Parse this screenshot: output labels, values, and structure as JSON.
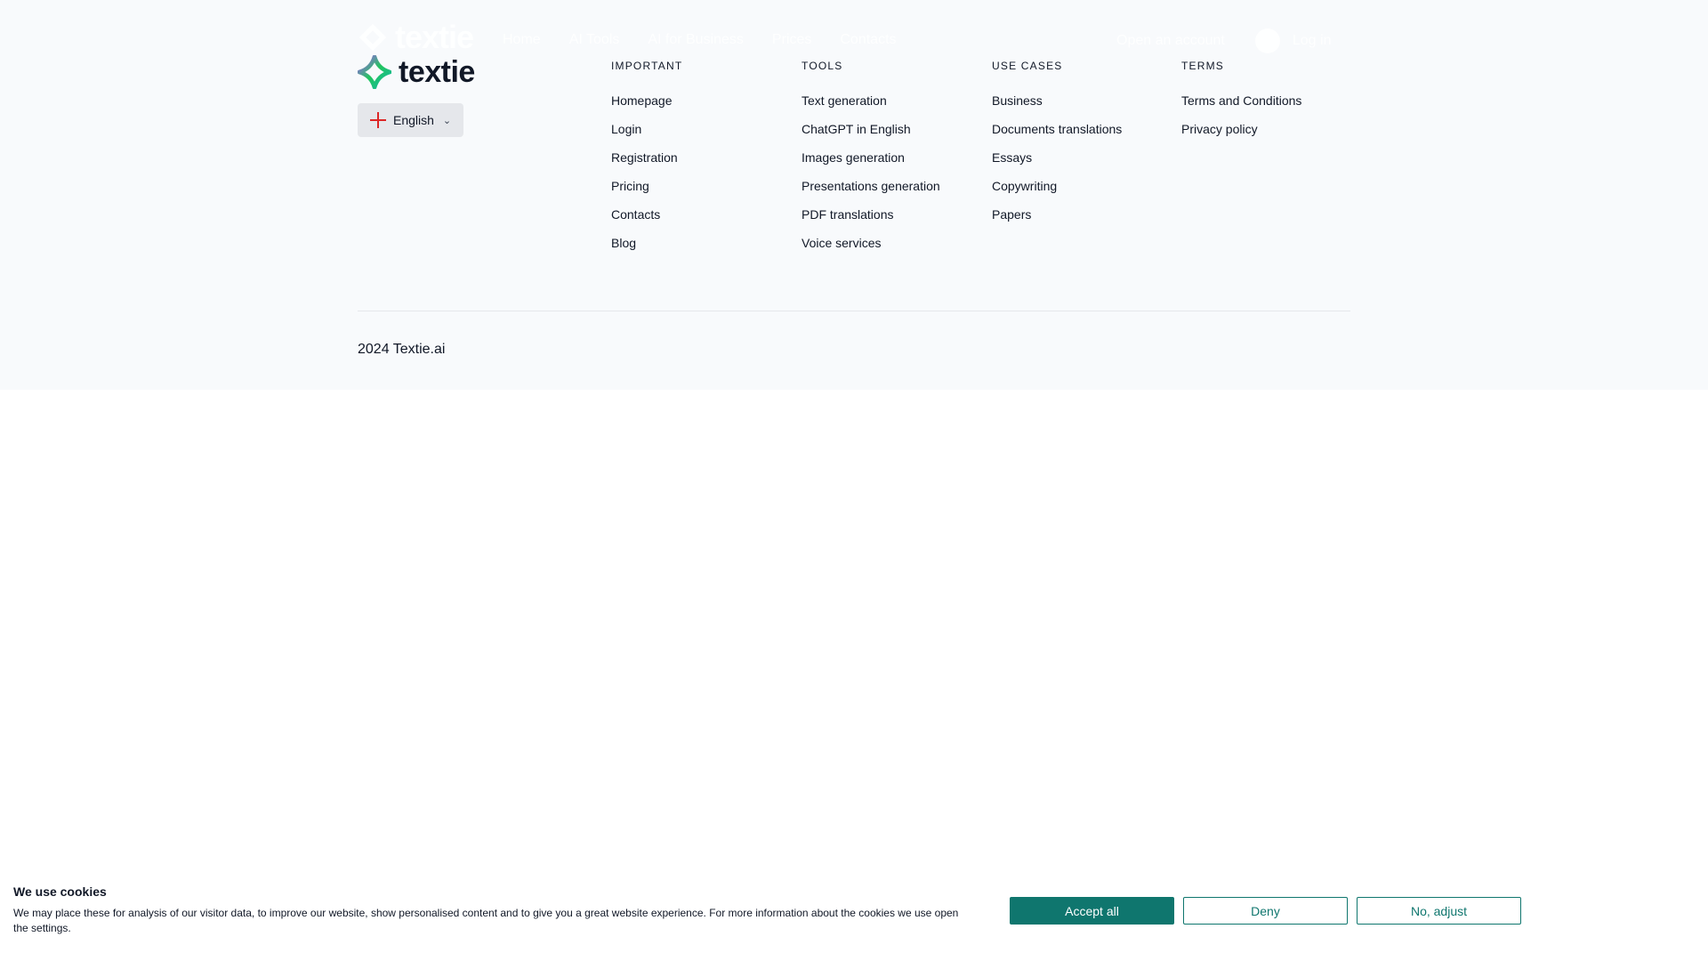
{
  "ghost_header": {
    "logo": "textie",
    "nav": [
      "Home",
      "AI Tools",
      "AI for Business",
      "Prices",
      "Contacts"
    ],
    "cta": "Open an account",
    "login": "Log in"
  },
  "footer": {
    "brand": "textie",
    "language": "English",
    "columns": [
      {
        "title": "IMPORTANT",
        "items": [
          "Homepage",
          "Login",
          "Registration",
          "Pricing",
          "Contacts",
          "Blog"
        ]
      },
      {
        "title": "TOOLS",
        "items": [
          "Text generation",
          "ChatGPT in English",
          "Images generation",
          "Presentations generation",
          "PDF translations",
          "Voice services"
        ]
      },
      {
        "title": "USE CASES",
        "items": [
          "Business",
          "Documents translations",
          "Essays",
          "Copywriting",
          "Papers"
        ]
      },
      {
        "title": "TERMS",
        "items": [
          "Terms and Conditions",
          "Privacy policy"
        ]
      }
    ],
    "copyright": "2024 Textie.ai"
  },
  "cookie": {
    "title": "We use cookies",
    "text": "We may place these for analysis of our visitor data, to improve our website, show personalised content and to give you a great website experience. For more information about the cookies we use open the settings.",
    "accept": "Accept all",
    "deny": "Deny",
    "adjust": "No, adjust"
  },
  "colors": {
    "footer_bg": "#f8fafc",
    "accent": "#0f766e",
    "flag_red": "#dc2626"
  }
}
